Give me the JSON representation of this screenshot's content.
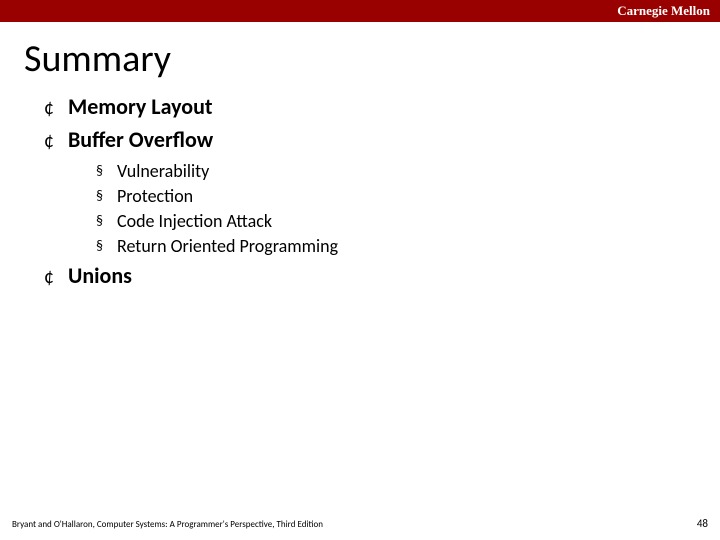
{
  "header": {
    "org": "Carnegie Mellon"
  },
  "title": "Summary",
  "topics": {
    "t0": {
      "label": "Memory Layout"
    },
    "t1": {
      "label": "Buffer Overflow"
    },
    "t1sub": {
      "s0": "Vulnerability",
      "s1": "Protection",
      "s2": "Code Injection Attack",
      "s3": "Return Oriented Programming"
    },
    "t2": {
      "label": "Unions"
    }
  },
  "footer": {
    "credit": "Bryant and O'Hallaron, Computer Systems: A Programmer's Perspective, Third Edition",
    "page": "48"
  },
  "bullets": {
    "hollow": "¢",
    "square": "§"
  }
}
